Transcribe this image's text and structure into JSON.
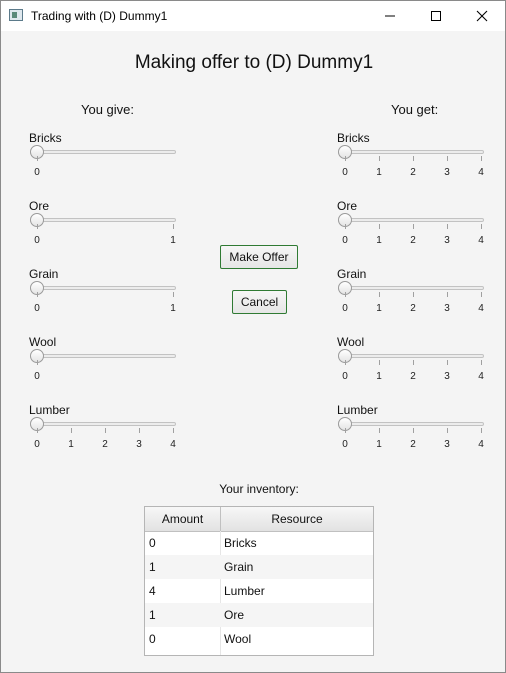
{
  "window": {
    "title": "Trading with (D) Dummy1"
  },
  "heading": "Making offer to (D) Dummy1",
  "give": {
    "header": "You give:",
    "sliders": [
      {
        "label": "Bricks",
        "ticks": [
          "0"
        ],
        "value": 0
      },
      {
        "label": "Ore",
        "ticks": [
          "0",
          "1"
        ],
        "value": 0
      },
      {
        "label": "Grain",
        "ticks": [
          "0",
          "1"
        ],
        "value": 0
      },
      {
        "label": "Wool",
        "ticks": [
          "0"
        ],
        "value": 0
      },
      {
        "label": "Lumber",
        "ticks": [
          "0",
          "1",
          "2",
          "3",
          "4"
        ],
        "value": 0
      }
    ]
  },
  "get": {
    "header": "You get:",
    "sliders": [
      {
        "label": "Bricks",
        "ticks": [
          "0",
          "1",
          "2",
          "3",
          "4"
        ],
        "value": 0
      },
      {
        "label": "Ore",
        "ticks": [
          "0",
          "1",
          "2",
          "3",
          "4"
        ],
        "value": 0
      },
      {
        "label": "Grain",
        "ticks": [
          "0",
          "1",
          "2",
          "3",
          "4"
        ],
        "value": 0
      },
      {
        "label": "Wool",
        "ticks": [
          "0",
          "1",
          "2",
          "3",
          "4"
        ],
        "value": 0
      },
      {
        "label": "Lumber",
        "ticks": [
          "0",
          "1",
          "2",
          "3",
          "4"
        ],
        "value": 0
      }
    ]
  },
  "buttons": {
    "make_offer": "Make Offer",
    "cancel": "Cancel"
  },
  "inventory": {
    "label": "Your inventory:",
    "columns": [
      "Amount",
      "Resource"
    ],
    "rows": [
      [
        "0",
        "Bricks"
      ],
      [
        "1",
        "Grain"
      ],
      [
        "4",
        "Lumber"
      ],
      [
        "1",
        "Ore"
      ],
      [
        "0",
        "Wool"
      ]
    ]
  },
  "colors": {
    "button_border": "#2f7a33",
    "background": "#f4f4f4"
  }
}
